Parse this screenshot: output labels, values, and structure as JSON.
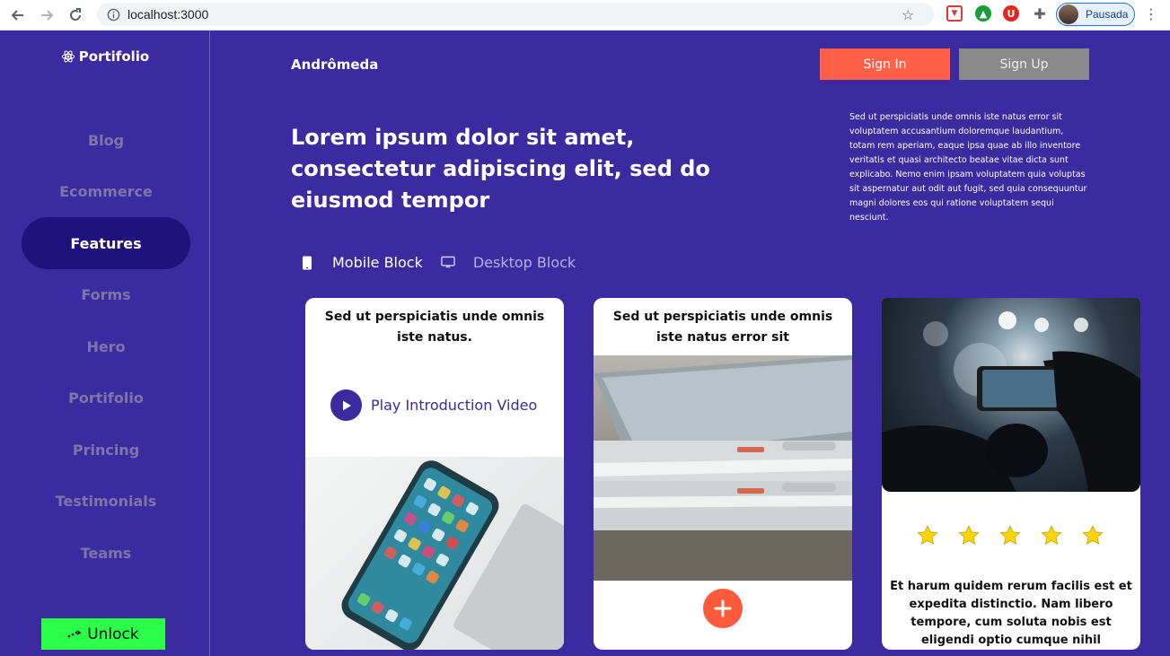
{
  "browser": {
    "url": "localhost:3000",
    "profile_name": "Pausada"
  },
  "sidebar": {
    "brand": "Portifolio",
    "items": [
      {
        "label": "Blog",
        "active": false
      },
      {
        "label": "Ecommerce",
        "active": false
      },
      {
        "label": "Features",
        "active": true
      },
      {
        "label": "Forms",
        "active": false
      },
      {
        "label": "Hero",
        "active": false
      },
      {
        "label": "Portifolio",
        "active": false
      },
      {
        "label": "Princing",
        "active": false
      },
      {
        "label": "Testimonials",
        "active": false
      },
      {
        "label": "Teams",
        "active": false
      }
    ],
    "unlock_label": "Unlock"
  },
  "header": {
    "title": "Andrômeda",
    "signin_label": "Sign In",
    "signup_label": "Sign Up"
  },
  "hero": {
    "title": "Lorem ipsum dolor sit amet, consectetur adipiscing elit, sed do eiusmod tempor",
    "description": "Sed ut perspiciatis unde omnis iste natus error sit voluptatem accusantium doloremque laudantium, totam rem aperiam, eaque ipsa quae ab illo inventore veritatis et quasi architecto beatae vitae dicta sunt explicabo. Nemo enim ipsam voluptatem quia voluptas sit aspernatur aut odit aut fugit, sed quia consequuntur magni dolores eos qui ratione voluptatem sequi nesciunt."
  },
  "tabs": [
    {
      "label": "Mobile Block",
      "icon": "mobile-icon",
      "active": true
    },
    {
      "label": "Desktop Block",
      "icon": "desktop-icon",
      "active": false
    }
  ],
  "cards": {
    "card1": {
      "title": "Sed ut perspiciatis unde omnis iste natus.",
      "play_label": "Play Introduction Video"
    },
    "card2": {
      "title": "Sed ut perspiciatis unde omnis iste natus error sit"
    },
    "card3": {
      "rating": 5,
      "review": "Et harum quidem rerum facilis est et expedita distinctio. Nam libero tempore, cum soluta nobis est eligendi optio cumque nihil"
    }
  },
  "colors": {
    "background": "#3b2aa0",
    "active_menu": "#20127a",
    "signin": "#ff6047",
    "signup": "#8a8a8a",
    "unlock": "#2cff47",
    "star": "#ffd400"
  }
}
